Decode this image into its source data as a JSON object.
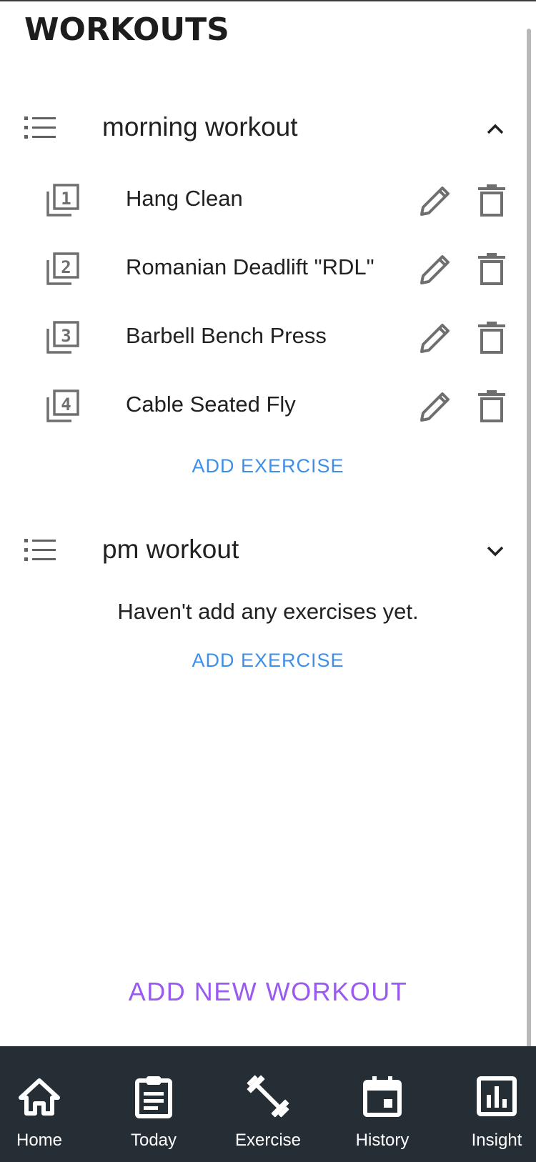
{
  "page": {
    "title": "WORKOUTS"
  },
  "workouts": [
    {
      "name": "morning workout",
      "expanded": true,
      "exercises": [
        {
          "index": "1",
          "name": "Hang Clean"
        },
        {
          "index": "2",
          "name": "Romanian Deadlift \"RDL\""
        },
        {
          "index": "3",
          "name": "Barbell Bench Press"
        },
        {
          "index": "4",
          "name": "Cable Seated Fly"
        }
      ],
      "add_exercise_label": "ADD EXERCISE"
    },
    {
      "name": "pm workout",
      "expanded": false,
      "empty_message": "Haven't add any exercises yet.",
      "add_exercise_label": "ADD EXERCISE"
    }
  ],
  "add_workout_label": "ADD NEW WORKOUT",
  "nav": {
    "items": [
      {
        "label": "Home",
        "icon": "home-icon"
      },
      {
        "label": "Today",
        "icon": "clipboard-icon"
      },
      {
        "label": "Exercise",
        "icon": "dumbbell-icon"
      },
      {
        "label": "History",
        "icon": "calendar-icon"
      },
      {
        "label": "Insight",
        "icon": "bar-chart-icon"
      }
    ]
  },
  "colors": {
    "link_blue": "#3f8fe8",
    "add_workout_purple": "#9a5af0",
    "nav_background": "#252d35",
    "icon_gray": "#757575"
  }
}
